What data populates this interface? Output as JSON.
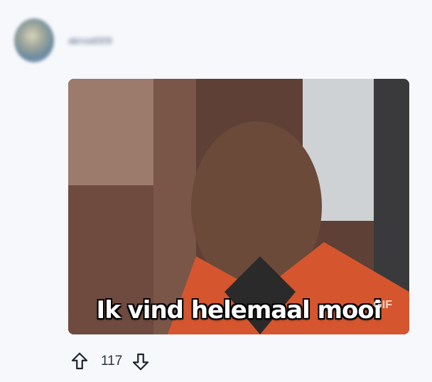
{
  "comment": {
    "username": "akrost009",
    "gif": {
      "caption": "Ik vind helemaal mooi",
      "badge": "GIF"
    },
    "votes": {
      "count": "117"
    }
  },
  "icons": {
    "upvote": "arrow-up-outline-icon",
    "downvote": "arrow-down-outline-icon"
  }
}
